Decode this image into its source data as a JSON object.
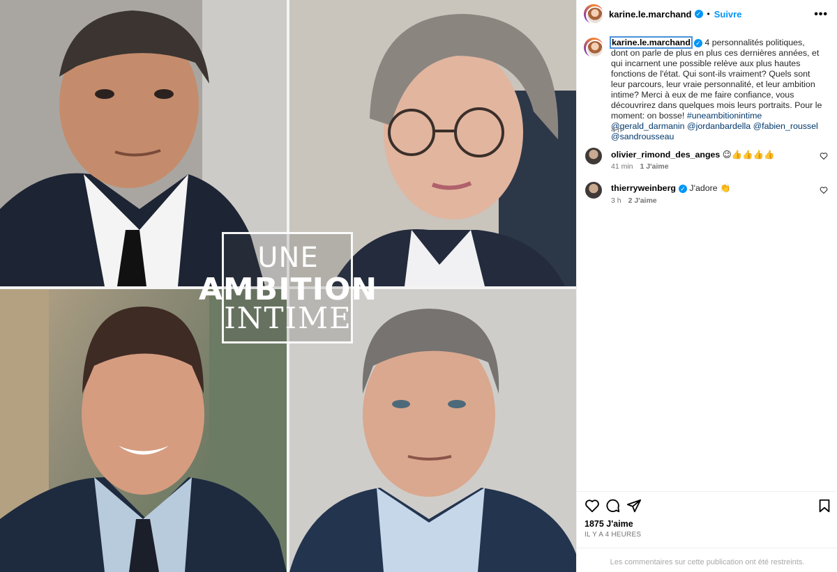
{
  "media": {
    "overlay_line1": "UNE",
    "overlay_line2": "AMBITION",
    "overlay_line3": "INTIME"
  },
  "header": {
    "username": "karine.le.marchand",
    "separator": "•",
    "follow_label": "Suivre",
    "more_label": "•••"
  },
  "caption": {
    "username": "karine.le.marchand",
    "text": " 4 personnalités politiques, dont on parle de plus en plus ces dernières années, et qui incarnent une possible relève aux plus hautes fonctions de l'état. Qui sont-ils vraiment? Quels sont leur parcours, leur vraie personnalité, et leur ambition intime? Merci à eux de me faire confiance, vous découvrirez dans quelques mois leurs portraits. Pour le moment: on bosse! ",
    "hashtag": "#uneambitionintime",
    "mentions": [
      "@gerald_darmanin",
      "@jordanbardella",
      "@fabien_roussel",
      "@sandrousseau"
    ],
    "time": "4 h"
  },
  "comments": [
    {
      "user": "olivier_rimond_des_anges",
      "text": " 😉👍👍👍👍",
      "time": "41 min",
      "likes": "1 J'aime",
      "verified": false
    },
    {
      "user": "thierryweinberg",
      "text": " J'adore 👏",
      "time": "3 h",
      "likes": "2 J'aime",
      "verified": true
    }
  ],
  "footer": {
    "likes_count": "1875 J'aime",
    "ago": "IL Y A 4 HEURES",
    "restricted": "Les commentaires sur cette publication ont été restreints."
  },
  "colors": {
    "accent": "#0095f6",
    "link": "#00376b",
    "muted": "#737373"
  },
  "icons": [
    "heart-icon",
    "comment-icon",
    "share-icon",
    "bookmark-icon",
    "verified-icon",
    "more-icon"
  ]
}
